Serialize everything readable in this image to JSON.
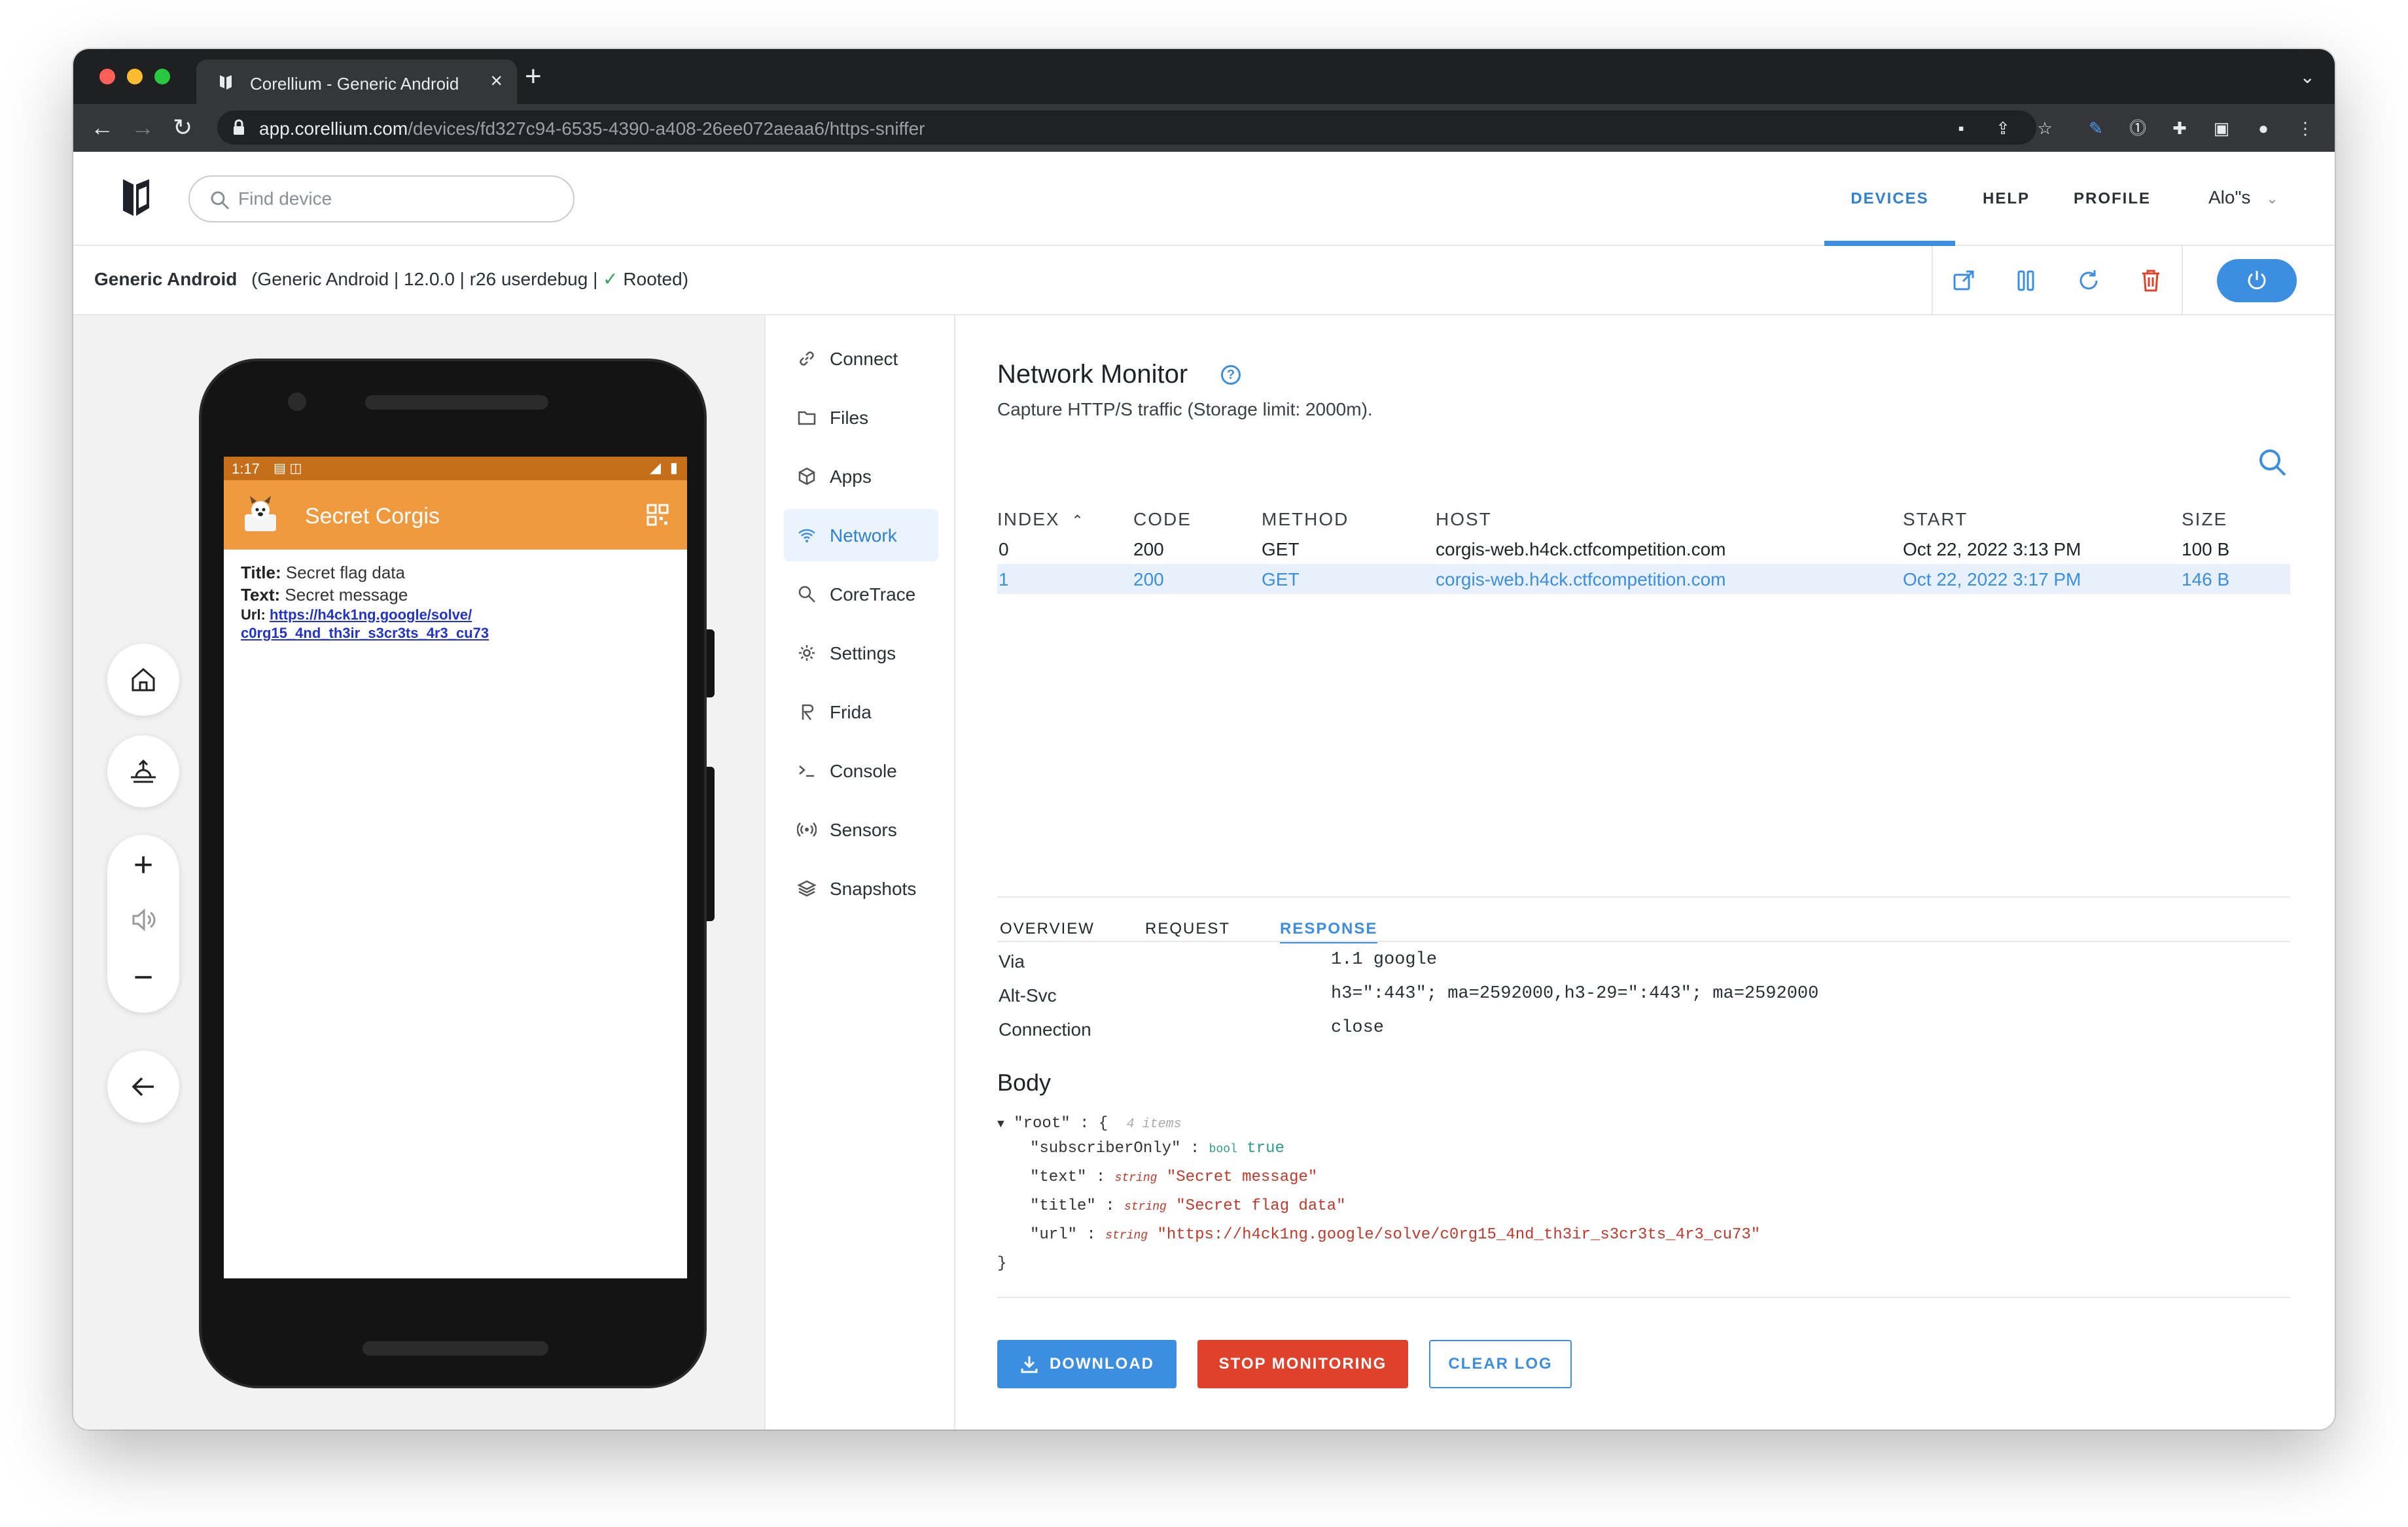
{
  "browser": {
    "tab_title": "Corellium - Generic Android",
    "url_domain": "app.corellium.com",
    "url_path": "/devices/fd327c94-6535-4390-a408-26ee072aeaa6/https-sniffer"
  },
  "header": {
    "search_placeholder": "Find device",
    "nav": [
      "DEVICES",
      "HELP",
      "PROFILE"
    ],
    "active_nav": "DEVICES",
    "user": "Alo\"s"
  },
  "device": {
    "name": "Generic Android",
    "details": "(Generic Android | 12.0.0 | r26 userdebug |",
    "rooted": "Rooted)"
  },
  "phone": {
    "time": "1:17",
    "app_title": "Secret Corgis",
    "title_label": "Title:",
    "title_value": " Secret flag data",
    "text_label": "Text:",
    "text_value": " Secret message",
    "url_label": "Url:",
    "url_line1": "https://h4ck1ng.google/solve/",
    "url_line2": "c0rg15_4nd_th3ir_s3cr3ts_4r3_cu73"
  },
  "menu": {
    "items": [
      {
        "label": "Connect",
        "icon": "link-icon"
      },
      {
        "label": "Files",
        "icon": "folder-icon"
      },
      {
        "label": "Apps",
        "icon": "cube-icon"
      },
      {
        "label": "Network",
        "icon": "wifi-icon"
      },
      {
        "label": "CoreTrace",
        "icon": "search-icon"
      },
      {
        "label": "Settings",
        "icon": "gear-icon"
      },
      {
        "label": "Frida",
        "icon": "frida-icon"
      },
      {
        "label": "Console",
        "icon": "terminal-icon"
      },
      {
        "label": "Sensors",
        "icon": "sensor-icon"
      },
      {
        "label": "Snapshots",
        "icon": "layers-icon"
      }
    ],
    "active": "Network"
  },
  "main": {
    "title": "Network Monitor",
    "subtitle": "Capture HTTP/S traffic (Storage limit: 2000m).",
    "columns": [
      "INDEX",
      "CODE",
      "METHOD",
      "HOST",
      "START",
      "SIZE"
    ],
    "rows": [
      {
        "index": "0",
        "code": "200",
        "method": "GET",
        "host": "corgis-web.h4ck.ctfcompetition.com",
        "start": "Oct 22, 2022 3:13 PM",
        "size": "100 B"
      },
      {
        "index": "1",
        "code": "200",
        "method": "GET",
        "host": "corgis-web.h4ck.ctfcompetition.com",
        "start": "Oct 22, 2022 3:17 PM",
        "size": "146 B"
      }
    ],
    "detail_tabs": [
      "OVERVIEW",
      "REQUEST",
      "RESPONSE"
    ],
    "active_detail_tab": "RESPONSE",
    "headers": [
      {
        "key": "Via",
        "value": "1.1 google"
      },
      {
        "key": "Alt-Svc",
        "value": "h3=\":443\"; ma=2592000,h3-29=\":443\"; ma=2592000"
      },
      {
        "key": "Connection",
        "value": "close"
      }
    ],
    "body_title": "Body",
    "json": {
      "root_key": "\"root\"",
      "root_count": "4 items",
      "fields": [
        {
          "key": "\"subscriberOnly\"",
          "type": "bool",
          "value": "true"
        },
        {
          "key": "\"text\"",
          "type": "string",
          "value": "\"Secret message\""
        },
        {
          "key": "\"title\"",
          "type": "string",
          "value": "\"Secret flag data\""
        },
        {
          "key": "\"url\"",
          "type": "string",
          "value": "\"https://h4ck1ng.google/solve/c0rg15_4nd_th3ir_s3cr3ts_4r3_cu73\""
        }
      ]
    },
    "buttons": {
      "download": "DOWNLOAD",
      "stop": "STOP MONITORING",
      "clear": "CLEAR LOG"
    }
  },
  "colors": {
    "accent": "#3b8ee0",
    "danger": "#e0412b",
    "app_bar": "#ef9a3f"
  }
}
